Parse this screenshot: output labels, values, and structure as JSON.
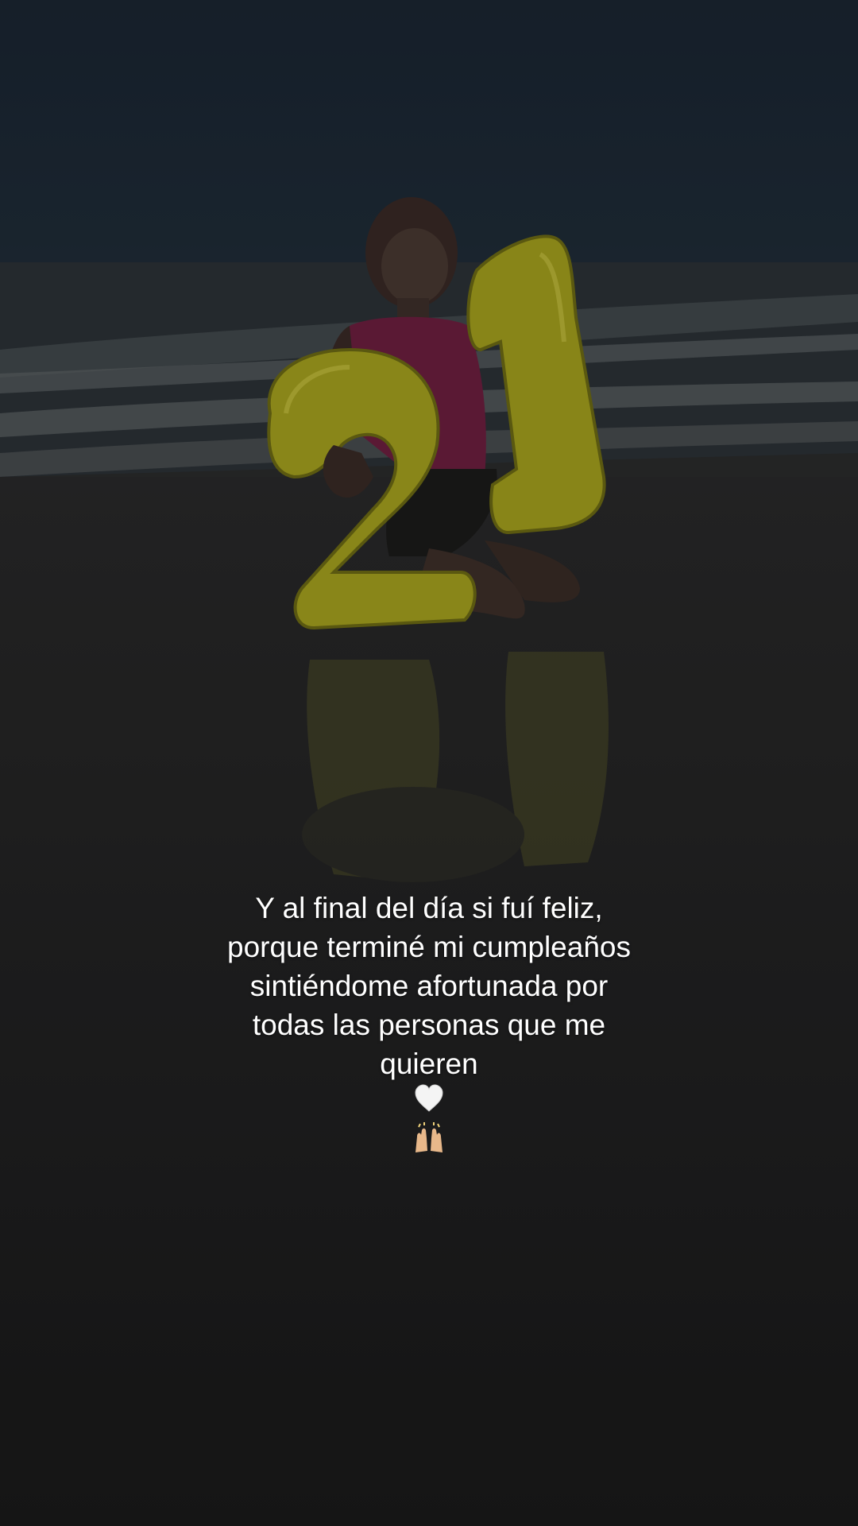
{
  "caption": {
    "lines": [
      "Y al final del día si fuí feliz,",
      "porque terminé mi cumpleaños",
      "sintiéndome afortunada por",
      "todas las personas que me",
      "quieren"
    ],
    "emoji": [
      "white-heart-icon",
      "raising-hands-icon"
    ]
  },
  "balloons": {
    "text": "21",
    "color": "#b8b41e"
  },
  "colors": {
    "text": "#ffffff",
    "tank_top": "#8a1f4a"
  }
}
